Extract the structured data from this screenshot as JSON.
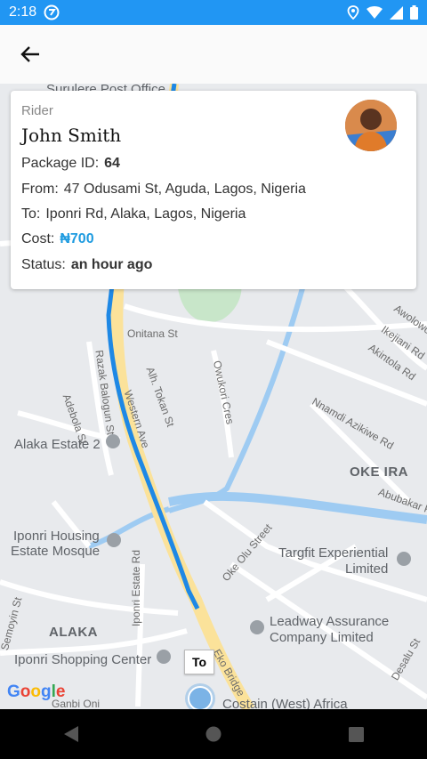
{
  "status_bar": {
    "time": "2:18"
  },
  "card": {
    "role_label": "Rider",
    "name": "John Smith",
    "package_id_label": "Package ID:",
    "package_id": "64",
    "from_label": "From:",
    "from": "47 Odusami St, Aguda, Lagos, Nigeria",
    "to_label": "To:",
    "to": "Iponri Rd, Alaka, Lagos, Nigeria",
    "cost_label": "Cost:",
    "cost": "₦700",
    "status_label": "Status:",
    "status": "an hour ago"
  },
  "map": {
    "marker_label": "To",
    "google": "Google",
    "labels": {
      "surulere": "Surulere Post Office",
      "onitana": "Onitana St",
      "awolowo": "Awolowo",
      "ikejiani": "Ikejiani Rd",
      "akintola": "Akintola Rd",
      "razak": "Razak Balogun St",
      "alh_tokan": "Alh. Tokan St",
      "owukori": "Owukori Cres",
      "adebola": "Adebola St",
      "western": "Western Ave",
      "alaka_estate": "Alaka Estate 2",
      "nnamdi": "Nnamdi Azikiwe Rd",
      "oke_ira": "OKE IRA",
      "abubakar": "Abubakar P",
      "iponri_housing_1": "Iponri Housing",
      "iponri_housing_2": "Estate Mosque",
      "oke_olu": "Oke Olu Street",
      "targfit_1": "Targfit Experiential",
      "targfit_2": "Limited",
      "iponri_estate_rd": "Iponri Estate Rd",
      "leadway_1": "Leadway Assurance",
      "leadway_2": "Company Limited",
      "alaka": "ALAKA",
      "iponri_shopping": "Iponri Shopping Center",
      "eko_bridge": "Eko Bridge",
      "desalu": "Desalu St",
      "costain": "Costain (West) Africa",
      "semoyin": "Semoyin St",
      "ganbi": "Ganbi Oni"
    }
  },
  "icons": {
    "back": "arrow-left-icon",
    "nav_back": "triangle-back-icon",
    "nav_home": "circle-home-icon",
    "nav_recents": "square-recents-icon"
  },
  "colors": {
    "accent": "#2196f3",
    "route": "#1e88e5",
    "cost": "#1e9be0"
  }
}
